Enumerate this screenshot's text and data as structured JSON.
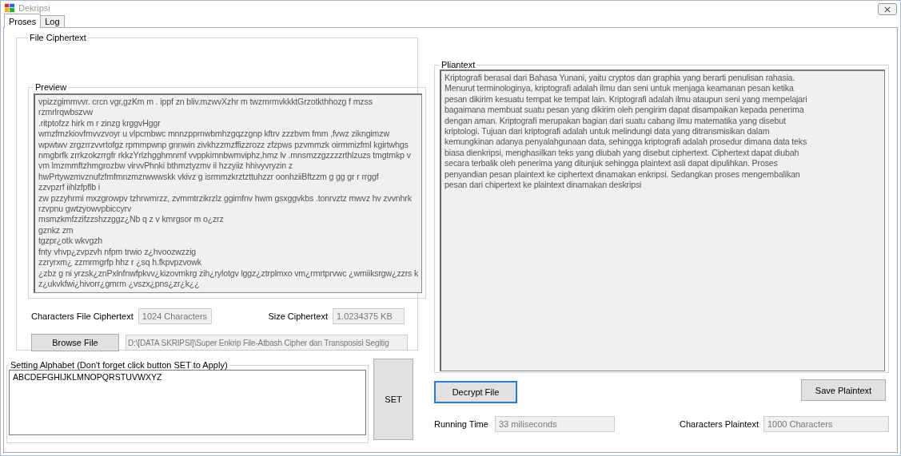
{
  "window": {
    "title": "Dekripsi"
  },
  "tabs": [
    {
      "label": "Proses",
      "selected": true
    },
    {
      "label": "Log",
      "selected": false
    }
  ],
  "file_ciphertext": {
    "title": "File Ciphertext",
    "preview": {
      "title": "Preview",
      "lines": [
        "vpizzgimmvvr. crcn vgr,gzKm m  . ippf zn bliv.mzwvXzhr m twzmrmvkkktGrzotkthhozg f mzss",
        "rzmrlrqwbszvw",
        ".ritptofzz hirk m r zinzg krggvHggr",
        "wmzfmzkiovfmvvzvoyr u   vlpcmbwc mnnzpprnwbmhzgqzzgnp kftrv zzzbvm fmm ,fvwz zikngimzw",
        "wpwtwv  zrgzrrzvvrtofgz rpmmpwnp gnnwin  zivkhzzmzffizzrozz zfzpws pzvmmzk oirmmizfml kgirtwhgs",
        "nmgbrfk zrrkzokzrrgfr  rkkzYrlzhgghmnmf vvppkimnbwmviphz,hmz lv  .mnsmzzgzzzzrthlzuzs  tmgtmkp  v",
        "vm lmzmmftzhmgrozbw  virvvPhnki bthmztyzmv il  hzzyiiz hhivyvryzin   z",
        "hwPrtywzmvznufzfmfmnzmzrwwwskk vkivz g isrmmzkrztzttuhzzr oonhziiBftzzm g gg gr r rrggf",
        "zzvpzrf iihlzfpflb i",
        "zw pzzyhrmi mxzgrowpv tzhrwmrzz, zvmmtrzikrzlz ggimfnv hwm gsxggvkbs .tonrvztz mwvz hv zvvnhrk",
        "rzvpnu gwtzyowvpbiccyrv",
        "msmzkmfzzifzzshzzggz¿Nb q z v kmrgsor m   o¿zrz",
        "gznkz    zm",
        "tgzpr¿otk wkvgzh",
        "fnty vhvp¿zvpzvh nfpm trwio z¿hvoozwzzig",
        "zzryrxm¿ zzmrmgrfp hhz r ¿sq h.fkpvpzvowk",
        "¿zbz  g ni yrzsk¿znPxlnfnwfpkvv¿kizovmkrg zih¿rylotgv lggz¿ztrplmxo vm¿rmrtprvwc ¿wmiiksrgw¿zzrs k",
        "z¿ukvkfwi¿hivorr¿gmrm ¿vszx¿pns¿zr¿k¿¿"
      ]
    },
    "characters_label": "Characters File Ciphertext",
    "characters_value": "1024 Characters",
    "size_label": "Size Ciphertext",
    "size_value": "1.0234375 KB",
    "browse_button": "Browse File",
    "path_value": "D:\\[DATA SKRIPSI]\\Super Enkrip File-Atbash Cipher dan Transposisi Segitig"
  },
  "alphabet": {
    "title": "Setting Alphabet (Don't forget click button SET to Apply)",
    "value": "ABCDEFGHIJKLMNOPQRSTUVWXYZ",
    "set_button": "SET"
  },
  "plaintext": {
    "title": "Pliantext",
    "lines": [
      "Kriptografi berasal dari Bahasa Yunani, yaitu cryptos dan graphia yang berarti penulisan rahasia.",
      "Menurut terminologinya, kriptografi adalah ilmu dan seni untuk menjaga keamanan pesan ketika",
      "pesan dikirim kesuatu tempat ke tempat lain. Kriptografi adalah ilmu ataupun seni yang mempelajari",
      "bagaimana membuat suatu pesan yang dikirim oleh pengirim dapat disampaikan kepada penerima",
      "dengan aman. Kriptografi merupakan bagian dari suatu cabang ilmu matematika yang disebut",
      "kriptologi. Tujuan dari kriptografi adalah untuk melindungi data yang ditransmisikan dalam",
      "kemungkinan adanya penyalahgunaan data, sehingga kriptografi adalah prosedur dimana data teks",
      "biasa dienkripsi, menghasilkan teks yang diubah yang disebut ciphertext. Ciphertext dapat diubah",
      "secara terbalik oleh penerima yang ditunjuk sehingga plaintext asli dapat dipulihkan. Proses",
      "penyandian pesan plaintext ke ciphertext dinamakan enkripsi. Sedangkan proses mengembalikan",
      "pesan dari chipertext ke plaintext dinamakan deskripsi"
    ],
    "decrypt_button": {
      "label": "Decrypt File",
      "focused": true
    },
    "save_button": "Save Plaintext",
    "running_label": "Running Time",
    "running_value": "33 miliseconds",
    "characters_label": "Characters Plaintext",
    "characters_value": "1000 Characters"
  }
}
